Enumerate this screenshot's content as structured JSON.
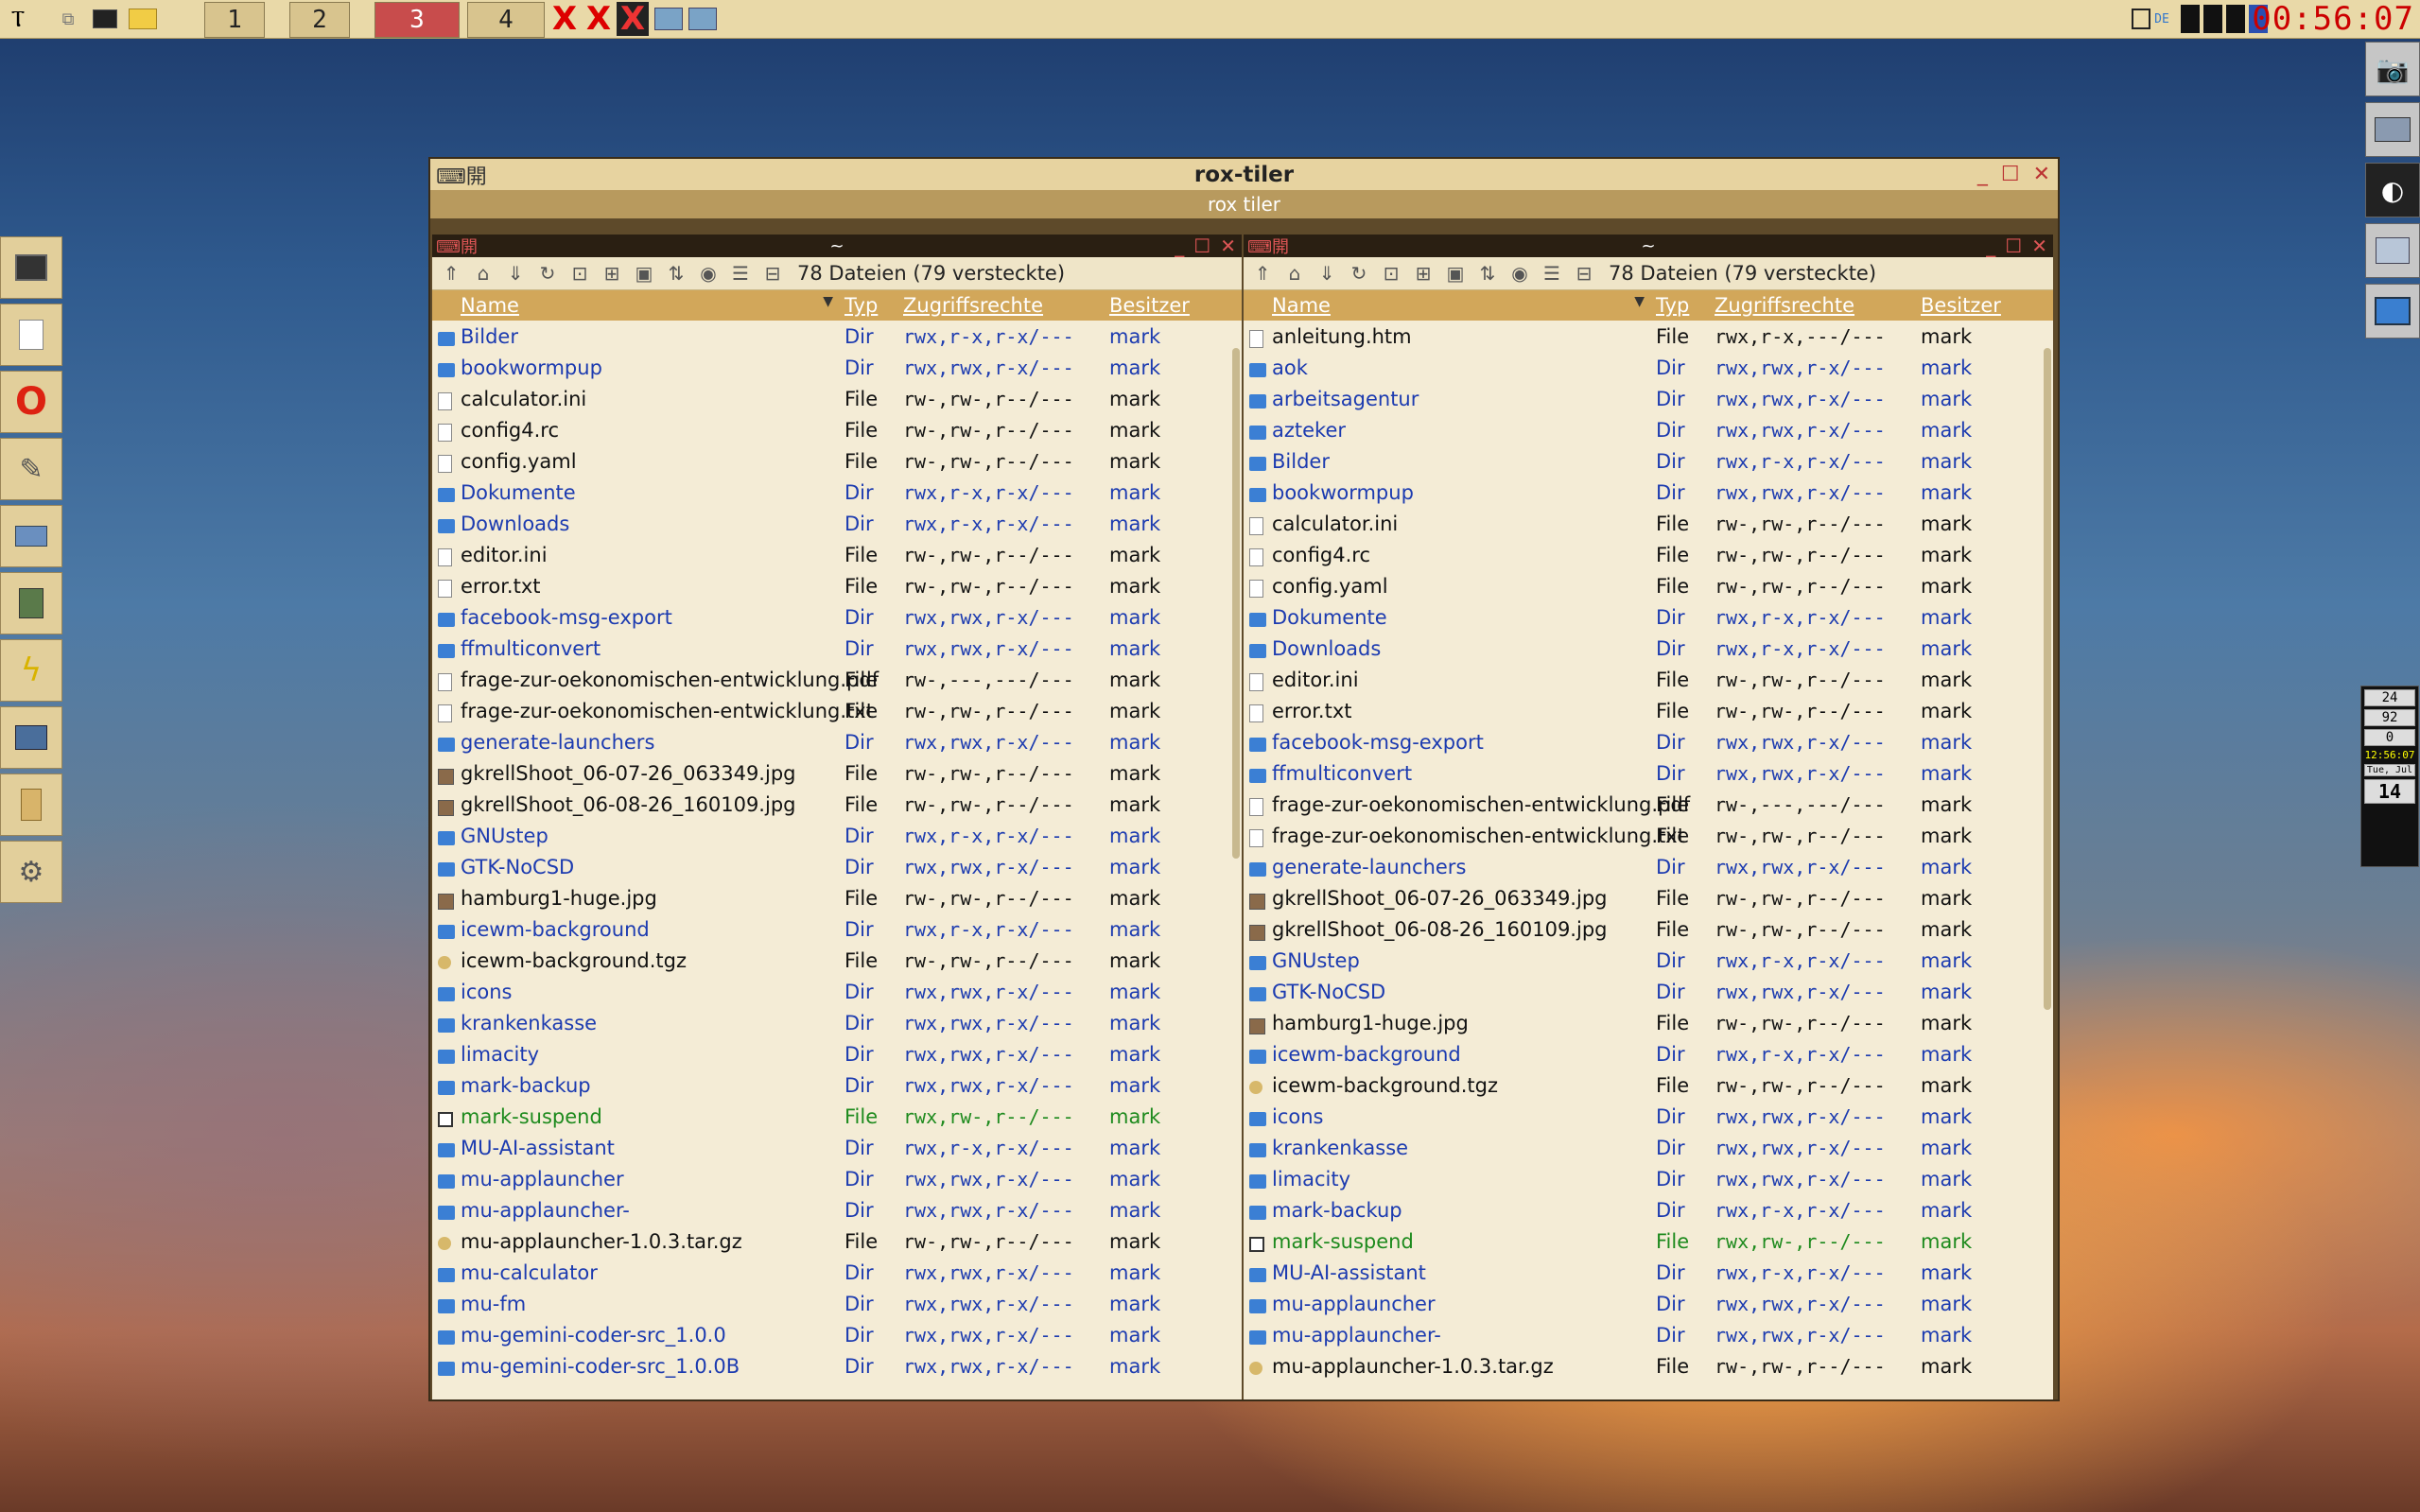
{
  "taskbar": {
    "workspaces": [
      "1",
      "2",
      "3",
      "4"
    ],
    "clock": "00:56:07",
    "lang": "DE"
  },
  "window": {
    "title": "rox-tiler",
    "subtitle": "rox tiler"
  },
  "panes": [
    {
      "path": "~",
      "count": "78 Dateien (79 versteckte)",
      "headers": {
        "name": "Name",
        "typ": "Typ",
        "perm": "Zugriffsrechte",
        "owner": "Besitzer"
      },
      "rows": [
        {
          "name": "Bilder",
          "typ": "Dir",
          "perm": "rwx,r-x,r-x/---",
          "owner": "mark",
          "kind": "dir"
        },
        {
          "name": "bookwormpup",
          "typ": "Dir",
          "perm": "rwx,rwx,r-x/---",
          "owner": "mark",
          "kind": "dir"
        },
        {
          "name": "calculator.ini",
          "typ": "File",
          "perm": "rw-,rw-,r--/---",
          "owner": "mark",
          "kind": "file"
        },
        {
          "name": "config4.rc",
          "typ": "File",
          "perm": "rw-,rw-,r--/---",
          "owner": "mark",
          "kind": "file"
        },
        {
          "name": "config.yaml",
          "typ": "File",
          "perm": "rw-,rw-,r--/---",
          "owner": "mark",
          "kind": "file"
        },
        {
          "name": "Dokumente",
          "typ": "Dir",
          "perm": "rwx,r-x,r-x/---",
          "owner": "mark",
          "kind": "dir"
        },
        {
          "name": "Downloads",
          "typ": "Dir",
          "perm": "rwx,r-x,r-x/---",
          "owner": "mark",
          "kind": "dir"
        },
        {
          "name": "editor.ini",
          "typ": "File",
          "perm": "rw-,rw-,r--/---",
          "owner": "mark",
          "kind": "file"
        },
        {
          "name": "error.txt",
          "typ": "File",
          "perm": "rw-,rw-,r--/---",
          "owner": "mark",
          "kind": "file"
        },
        {
          "name": "facebook-msg-export",
          "typ": "Dir",
          "perm": "rwx,rwx,r-x/---",
          "owner": "mark",
          "kind": "dir"
        },
        {
          "name": "ffmulticonvert",
          "typ": "Dir",
          "perm": "rwx,rwx,r-x/---",
          "owner": "mark",
          "kind": "dir"
        },
        {
          "name": "frage-zur-oekonomischen-entwicklung.pdf",
          "typ": "File",
          "perm": "rw-,---,---/---",
          "owner": "mark",
          "kind": "file"
        },
        {
          "name": "frage-zur-oekonomischen-entwicklung.txt",
          "typ": "File",
          "perm": "rw-,rw-,r--/---",
          "owner": "mark",
          "kind": "file"
        },
        {
          "name": "generate-launchers",
          "typ": "Dir",
          "perm": "rwx,rwx,r-x/---",
          "owner": "mark",
          "kind": "dir"
        },
        {
          "name": "gkrellShoot_06-07-26_063349.jpg",
          "typ": "File",
          "perm": "rw-,rw-,r--/---",
          "owner": "mark",
          "kind": "img"
        },
        {
          "name": "gkrellShoot_06-08-26_160109.jpg",
          "typ": "File",
          "perm": "rw-,rw-,r--/---",
          "owner": "mark",
          "kind": "img"
        },
        {
          "name": "GNUstep",
          "typ": "Dir",
          "perm": "rwx,r-x,r-x/---",
          "owner": "mark",
          "kind": "dir"
        },
        {
          "name": "GTK-NoCSD",
          "typ": "Dir",
          "perm": "rwx,rwx,r-x/---",
          "owner": "mark",
          "kind": "dir"
        },
        {
          "name": "hamburg1-huge.jpg",
          "typ": "File",
          "perm": "rw-,rw-,r--/---",
          "owner": "mark",
          "kind": "img"
        },
        {
          "name": "icewm-background",
          "typ": "Dir",
          "perm": "rwx,r-x,r-x/---",
          "owner": "mark",
          "kind": "dir"
        },
        {
          "name": "icewm-background.tgz",
          "typ": "File",
          "perm": "rw-,rw-,r--/---",
          "owner": "mark",
          "kind": "arch"
        },
        {
          "name": "icons",
          "typ": "Dir",
          "perm": "rwx,rwx,r-x/---",
          "owner": "mark",
          "kind": "dir"
        },
        {
          "name": "krankenkasse",
          "typ": "Dir",
          "perm": "rwx,rwx,r-x/---",
          "owner": "mark",
          "kind": "dir"
        },
        {
          "name": "limacity",
          "typ": "Dir",
          "perm": "rwx,rwx,r-x/---",
          "owner": "mark",
          "kind": "dir"
        },
        {
          "name": "mark-backup",
          "typ": "Dir",
          "perm": "rwx,rwx,r-x/---",
          "owner": "mark",
          "kind": "dir"
        },
        {
          "name": "mark-suspend",
          "typ": "File",
          "perm": "rwx,rw-,r--/---",
          "owner": "mark",
          "kind": "exec"
        },
        {
          "name": "MU-AI-assistant",
          "typ": "Dir",
          "perm": "rwx,r-x,r-x/---",
          "owner": "mark",
          "kind": "dir"
        },
        {
          "name": "mu-applauncher",
          "typ": "Dir",
          "perm": "rwx,rwx,r-x/---",
          "owner": "mark",
          "kind": "dir"
        },
        {
          "name": "mu-applauncher-",
          "typ": "Dir",
          "perm": "rwx,rwx,r-x/---",
          "owner": "mark",
          "kind": "dir"
        },
        {
          "name": "mu-applauncher-1.0.3.tar.gz",
          "typ": "File",
          "perm": "rw-,rw-,r--/---",
          "owner": "mark",
          "kind": "arch"
        },
        {
          "name": "mu-calculator",
          "typ": "Dir",
          "perm": "rwx,rwx,r-x/---",
          "owner": "mark",
          "kind": "dir"
        },
        {
          "name": "mu-fm",
          "typ": "Dir",
          "perm": "rwx,rwx,r-x/---",
          "owner": "mark",
          "kind": "dir"
        },
        {
          "name": "mu-gemini-coder-src_1.0.0",
          "typ": "Dir",
          "perm": "rwx,rwx,r-x/---",
          "owner": "mark",
          "kind": "dir"
        },
        {
          "name": "mu-gemini-coder-src_1.0.0B",
          "typ": "Dir",
          "perm": "rwx,rwx,r-x/---",
          "owner": "mark",
          "kind": "dir"
        }
      ]
    },
    {
      "path": "~",
      "count": "78 Dateien (79 versteckte)",
      "headers": {
        "name": "Name",
        "typ": "Typ",
        "perm": "Zugriffsrechte",
        "owner": "Besitzer"
      },
      "rows": [
        {
          "name": "anleitung.htm",
          "typ": "File",
          "perm": "rwx,r-x,---/---",
          "owner": "mark",
          "kind": "file"
        },
        {
          "name": "aok",
          "typ": "Dir",
          "perm": "rwx,rwx,r-x/---",
          "owner": "mark",
          "kind": "dir"
        },
        {
          "name": "arbeitsagentur",
          "typ": "Dir",
          "perm": "rwx,rwx,r-x/---",
          "owner": "mark",
          "kind": "dir"
        },
        {
          "name": "azteker",
          "typ": "Dir",
          "perm": "rwx,rwx,r-x/---",
          "owner": "mark",
          "kind": "dir"
        },
        {
          "name": "Bilder",
          "typ": "Dir",
          "perm": "rwx,r-x,r-x/---",
          "owner": "mark",
          "kind": "dir"
        },
        {
          "name": "bookwormpup",
          "typ": "Dir",
          "perm": "rwx,rwx,r-x/---",
          "owner": "mark",
          "kind": "dir"
        },
        {
          "name": "calculator.ini",
          "typ": "File",
          "perm": "rw-,rw-,r--/---",
          "owner": "mark",
          "kind": "file"
        },
        {
          "name": "config4.rc",
          "typ": "File",
          "perm": "rw-,rw-,r--/---",
          "owner": "mark",
          "kind": "file"
        },
        {
          "name": "config.yaml",
          "typ": "File",
          "perm": "rw-,rw-,r--/---",
          "owner": "mark",
          "kind": "file"
        },
        {
          "name": "Dokumente",
          "typ": "Dir",
          "perm": "rwx,r-x,r-x/---",
          "owner": "mark",
          "kind": "dir"
        },
        {
          "name": "Downloads",
          "typ": "Dir",
          "perm": "rwx,r-x,r-x/---",
          "owner": "mark",
          "kind": "dir"
        },
        {
          "name": "editor.ini",
          "typ": "File",
          "perm": "rw-,rw-,r--/---",
          "owner": "mark",
          "kind": "file"
        },
        {
          "name": "error.txt",
          "typ": "File",
          "perm": "rw-,rw-,r--/---",
          "owner": "mark",
          "kind": "file"
        },
        {
          "name": "facebook-msg-export",
          "typ": "Dir",
          "perm": "rwx,rwx,r-x/---",
          "owner": "mark",
          "kind": "dir"
        },
        {
          "name": "ffmulticonvert",
          "typ": "Dir",
          "perm": "rwx,rwx,r-x/---",
          "owner": "mark",
          "kind": "dir"
        },
        {
          "name": "frage-zur-oekonomischen-entwicklung.pdf",
          "typ": "File",
          "perm": "rw-,---,---/---",
          "owner": "mark",
          "kind": "file"
        },
        {
          "name": "frage-zur-oekonomischen-entwicklung.txt",
          "typ": "File",
          "perm": "rw-,rw-,r--/---",
          "owner": "mark",
          "kind": "file"
        },
        {
          "name": "generate-launchers",
          "typ": "Dir",
          "perm": "rwx,rwx,r-x/---",
          "owner": "mark",
          "kind": "dir"
        },
        {
          "name": "gkrellShoot_06-07-26_063349.jpg",
          "typ": "File",
          "perm": "rw-,rw-,r--/---",
          "owner": "mark",
          "kind": "img"
        },
        {
          "name": "gkrellShoot_06-08-26_160109.jpg",
          "typ": "File",
          "perm": "rw-,rw-,r--/---",
          "owner": "mark",
          "kind": "img"
        },
        {
          "name": "GNUstep",
          "typ": "Dir",
          "perm": "rwx,r-x,r-x/---",
          "owner": "mark",
          "kind": "dir"
        },
        {
          "name": "GTK-NoCSD",
          "typ": "Dir",
          "perm": "rwx,rwx,r-x/---",
          "owner": "mark",
          "kind": "dir"
        },
        {
          "name": "hamburg1-huge.jpg",
          "typ": "File",
          "perm": "rw-,rw-,r--/---",
          "owner": "mark",
          "kind": "img"
        },
        {
          "name": "icewm-background",
          "typ": "Dir",
          "perm": "rwx,r-x,r-x/---",
          "owner": "mark",
          "kind": "dir"
        },
        {
          "name": "icewm-background.tgz",
          "typ": "File",
          "perm": "rw-,rw-,r--/---",
          "owner": "mark",
          "kind": "arch"
        },
        {
          "name": "icons",
          "typ": "Dir",
          "perm": "rwx,rwx,r-x/---",
          "owner": "mark",
          "kind": "dir"
        },
        {
          "name": "krankenkasse",
          "typ": "Dir",
          "perm": "rwx,rwx,r-x/---",
          "owner": "mark",
          "kind": "dir"
        },
        {
          "name": "limacity",
          "typ": "Dir",
          "perm": "rwx,rwx,r-x/---",
          "owner": "mark",
          "kind": "dir"
        },
        {
          "name": "mark-backup",
          "typ": "Dir",
          "perm": "rwx,r-x,r-x/---",
          "owner": "mark",
          "kind": "dir"
        },
        {
          "name": "mark-suspend",
          "typ": "File",
          "perm": "rwx,rw-,r--/---",
          "owner": "mark",
          "kind": "exec"
        },
        {
          "name": "MU-AI-assistant",
          "typ": "Dir",
          "perm": "rwx,r-x,r-x/---",
          "owner": "mark",
          "kind": "dir"
        },
        {
          "name": "mu-applauncher",
          "typ": "Dir",
          "perm": "rwx,rwx,r-x/---",
          "owner": "mark",
          "kind": "dir"
        },
        {
          "name": "mu-applauncher-",
          "typ": "Dir",
          "perm": "rwx,rwx,r-x/---",
          "owner": "mark",
          "kind": "dir"
        },
        {
          "name": "mu-applauncher-1.0.3.tar.gz",
          "typ": "File",
          "perm": "rw-,rw-,r--/---",
          "owner": "mark",
          "kind": "arch"
        }
      ]
    }
  ],
  "gkrell": {
    "cpu": "24",
    "mem": "92",
    "net": "0",
    "time": "12:56:07",
    "date": "Tue, Jul",
    "day": "14"
  }
}
